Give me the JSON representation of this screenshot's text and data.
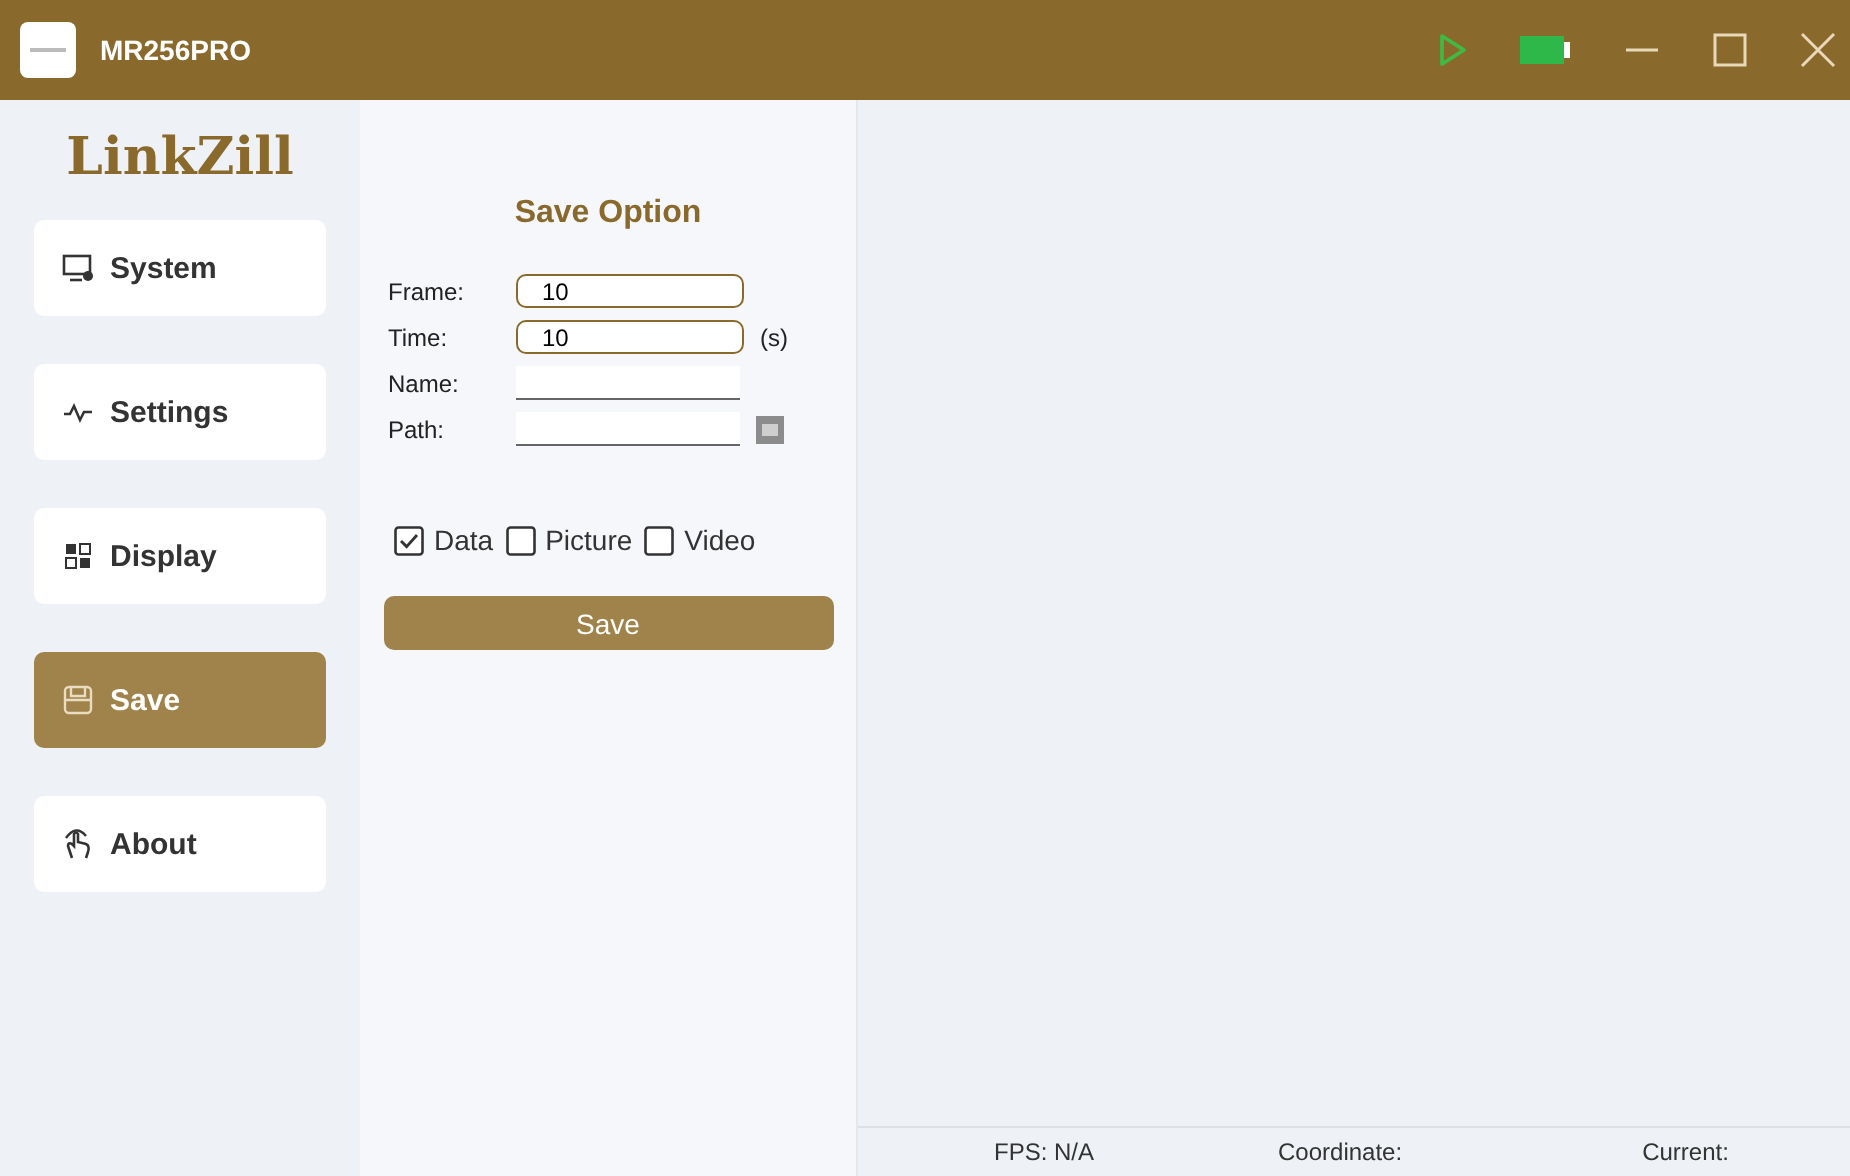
{
  "window": {
    "title": "MR256PRO",
    "running": true
  },
  "logo": "LinkZill",
  "sidebar": {
    "items": [
      {
        "label": "System",
        "kind": "system",
        "selected": false
      },
      {
        "label": "Settings",
        "kind": "settings",
        "selected": false
      },
      {
        "label": "Display",
        "kind": "display",
        "selected": false
      },
      {
        "label": "Save",
        "kind": "save",
        "selected": true
      },
      {
        "label": "About",
        "kind": "about",
        "selected": false
      }
    ]
  },
  "save_option": {
    "title": "Save Option",
    "fields": [
      {
        "label": "Frame:",
        "kind": "box",
        "value": "10"
      },
      {
        "label": "Time:",
        "kind": "box",
        "value": "10",
        "unit": "(s)"
      },
      {
        "label": "Name:",
        "kind": "line"
      },
      {
        "label": "Path:",
        "kind": "line",
        "browse": true
      }
    ],
    "checkboxes": [
      {
        "label": "Data",
        "checked": true
      },
      {
        "label": "Picture",
        "checked": false
      },
      {
        "label": "Video",
        "checked": false
      }
    ],
    "button": "Save"
  },
  "status_bar": [
    "FPS: N/A",
    "Coordinate:",
    "Current:"
  ]
}
